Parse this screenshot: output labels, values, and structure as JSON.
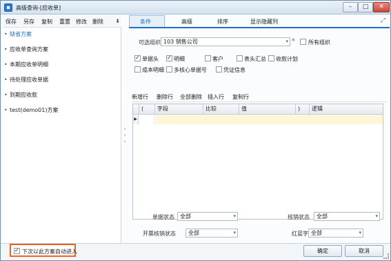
{
  "window": {
    "title": "高级查询-[应收单]"
  },
  "left": {
    "toolbar": [
      "保存",
      "另存",
      "复制",
      "重置",
      "修改",
      "删除"
    ],
    "pin": "⇟",
    "plans": [
      {
        "label": "缺省方案",
        "selected": true
      },
      {
        "label": "应收单查询方案",
        "selected": false
      },
      {
        "label": "本期应收单明细",
        "selected": false
      },
      {
        "label": "待处理应收单据",
        "selected": false
      },
      {
        "label": "到期应收款",
        "selected": false
      },
      {
        "label": "test(demo01)方案",
        "selected": false
      }
    ],
    "collapse_arrows": [
      "›",
      "‹",
      "‹"
    ]
  },
  "tabs": {
    "items": [
      "条件",
      "高级",
      "排序",
      "显示隐藏列"
    ],
    "active_index": 0,
    "expand_icon": "⤢"
  },
  "condition": {
    "org_label": "可选组织",
    "org_value": "103 销售公司",
    "required_mark": "*",
    "all_org_label": "所有组织",
    "checkboxes_row1": [
      {
        "label": "单据头",
        "checked": true
      },
      {
        "label": "明细",
        "checked": true
      },
      {
        "label": "客户",
        "checked": false
      },
      {
        "label": "表头汇总",
        "checked": false
      },
      {
        "label": "收款计划",
        "checked": false
      }
    ],
    "checkboxes_row2": [
      {
        "label": "成本明细",
        "checked": false
      },
      {
        "label": "多核心单据号",
        "checked": false
      },
      {
        "label": "凭证信息",
        "checked": false
      }
    ]
  },
  "grid": {
    "toolbar": [
      "新增行",
      "删除行",
      "全部删除",
      "插入行",
      "复制行"
    ],
    "columns": [
      "(",
      "字段",
      "比较",
      "值",
      ")",
      "逻辑"
    ],
    "row_marker": "▶"
  },
  "bottom": {
    "doc_status_label": "单据状态",
    "doc_status_value": "全部",
    "write_off_status_label": "核销状态",
    "write_off_status_value": "全部",
    "invoice_status_label": "开票核销状态",
    "invoice_status_value": "全部",
    "red_blue_label": "红蓝字",
    "red_blue_value": "全部"
  },
  "footer": {
    "auto_enter_label": "下次以此方案自动进入",
    "auto_enter_checked": true,
    "ok_label": "确定",
    "cancel_label": "取消"
  },
  "colors": {
    "accent": "#1f6fc8",
    "highlight": "#e8661c",
    "edit_row": "#fdf6d8"
  }
}
